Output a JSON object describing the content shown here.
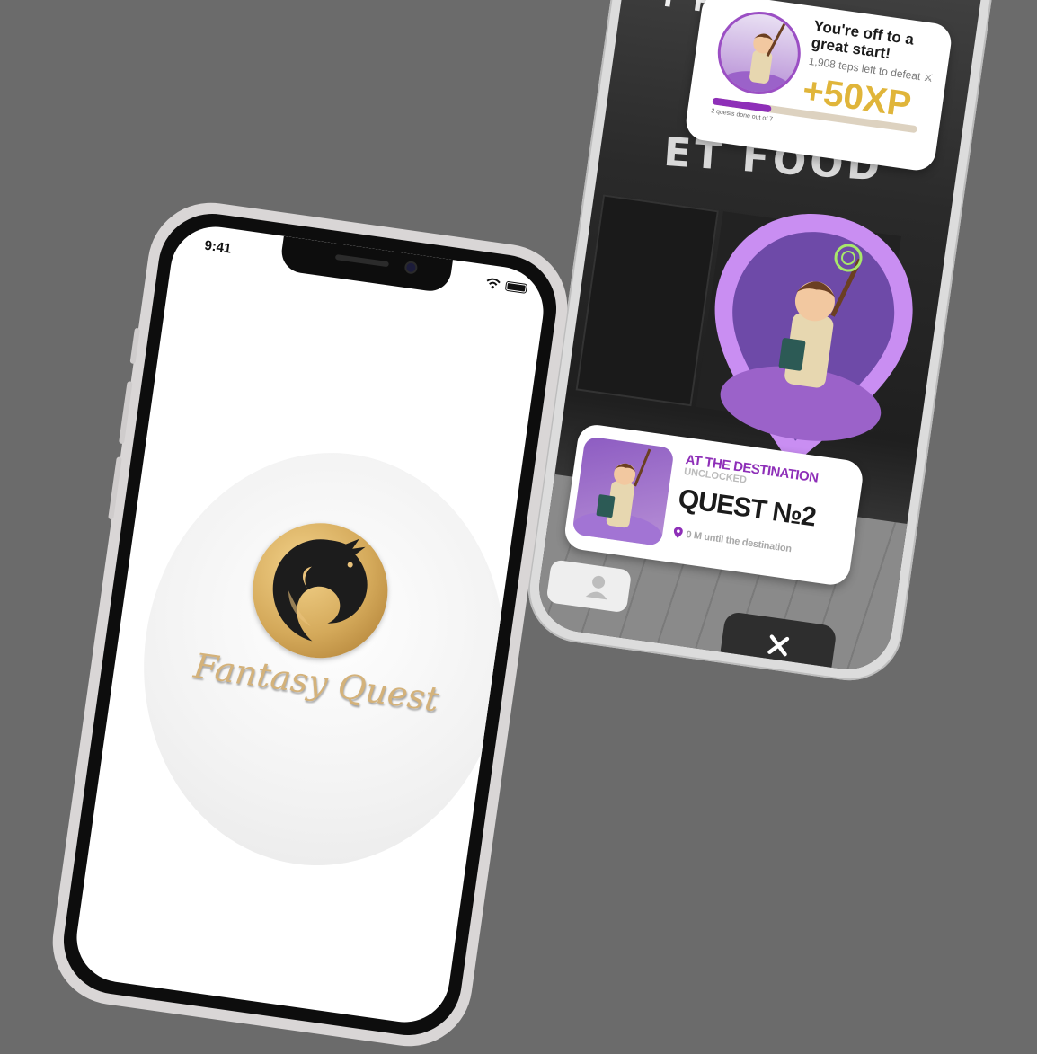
{
  "right_phone": {
    "xp_card": {
      "title": "You're off to a great start!",
      "subtitle": "1,908 teps left to defeat ⚔",
      "xp_amount": "+50XP",
      "progress_label": "2 quests done out of 7",
      "progress_fraction": 0.2857,
      "accent_color": "#8e2fb8",
      "xp_color": "#e0b53a"
    },
    "sign": {
      "top_text": "T FO",
      "main_text": "ET FOOD"
    },
    "destination_card": {
      "kicker": "AT THE DESTINATION",
      "status": "UNCLOCKED",
      "title": "QUEST №2",
      "distance": "0 M until the destination",
      "pin_color": "#c98ef2"
    },
    "close_button": {
      "icon": "close-icon"
    },
    "profile_button": {
      "icon": "person-icon"
    }
  },
  "left_phone": {
    "status_bar": {
      "time": "9:41"
    },
    "logo": {
      "icon": "dragon-icon"
    }
  }
}
